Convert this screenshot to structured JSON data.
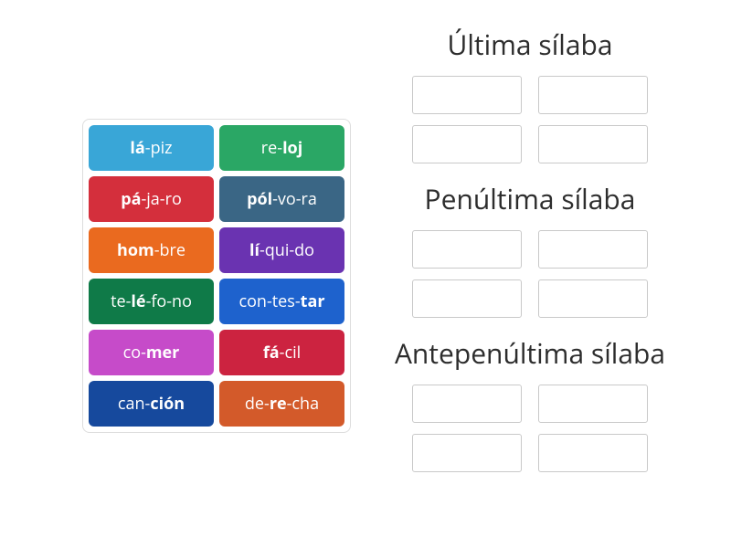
{
  "colors": {
    "skyblue": "#39a6d7",
    "green": "#2aa765",
    "red": "#d42f3c",
    "bluegrey": "#3a6685",
    "orange": "#ea6a1f",
    "purple": "#6a33b1",
    "darkgreen": "#0f7a48",
    "blue": "#1e62cd",
    "magenta": "#c64bc9",
    "crimson": "#cc2340",
    "navy": "#16499d",
    "rust": "#d35a2a"
  },
  "tiles": [
    {
      "syllables": [
        "lá",
        "piz"
      ],
      "stress_index": 0,
      "color": "skyblue"
    },
    {
      "syllables": [
        "re",
        "loj"
      ],
      "stress_index": 1,
      "color": "green"
    },
    {
      "syllables": [
        "pá",
        "ja",
        "ro"
      ],
      "stress_index": 0,
      "color": "red"
    },
    {
      "syllables": [
        "pól",
        "vo",
        "ra"
      ],
      "stress_index": 0,
      "color": "bluegrey"
    },
    {
      "syllables": [
        "hom",
        "bre"
      ],
      "stress_index": 0,
      "color": "orange"
    },
    {
      "syllables": [
        "lí",
        "qui",
        "do"
      ],
      "stress_index": 0,
      "color": "purple"
    },
    {
      "syllables": [
        "te",
        "lé",
        "fo",
        "no"
      ],
      "stress_index": 1,
      "color": "darkgreen"
    },
    {
      "syllables": [
        "con",
        "tes",
        "tar"
      ],
      "stress_index": 2,
      "color": "blue"
    },
    {
      "syllables": [
        "co",
        "mer"
      ],
      "stress_index": 1,
      "color": "magenta"
    },
    {
      "syllables": [
        "fá",
        "cil"
      ],
      "stress_index": 0,
      "color": "crimson"
    },
    {
      "syllables": [
        "can",
        "ción"
      ],
      "stress_index": 1,
      "color": "navy"
    },
    {
      "syllables": [
        "de",
        "re",
        "cha"
      ],
      "stress_index": 1,
      "color": "rust"
    }
  ],
  "zones": [
    {
      "title": "Última sílaba",
      "slots": 4
    },
    {
      "title": "Penúltima sílaba",
      "slots": 4
    },
    {
      "title": "Antepenúltima sílaba",
      "slots": 4
    }
  ]
}
